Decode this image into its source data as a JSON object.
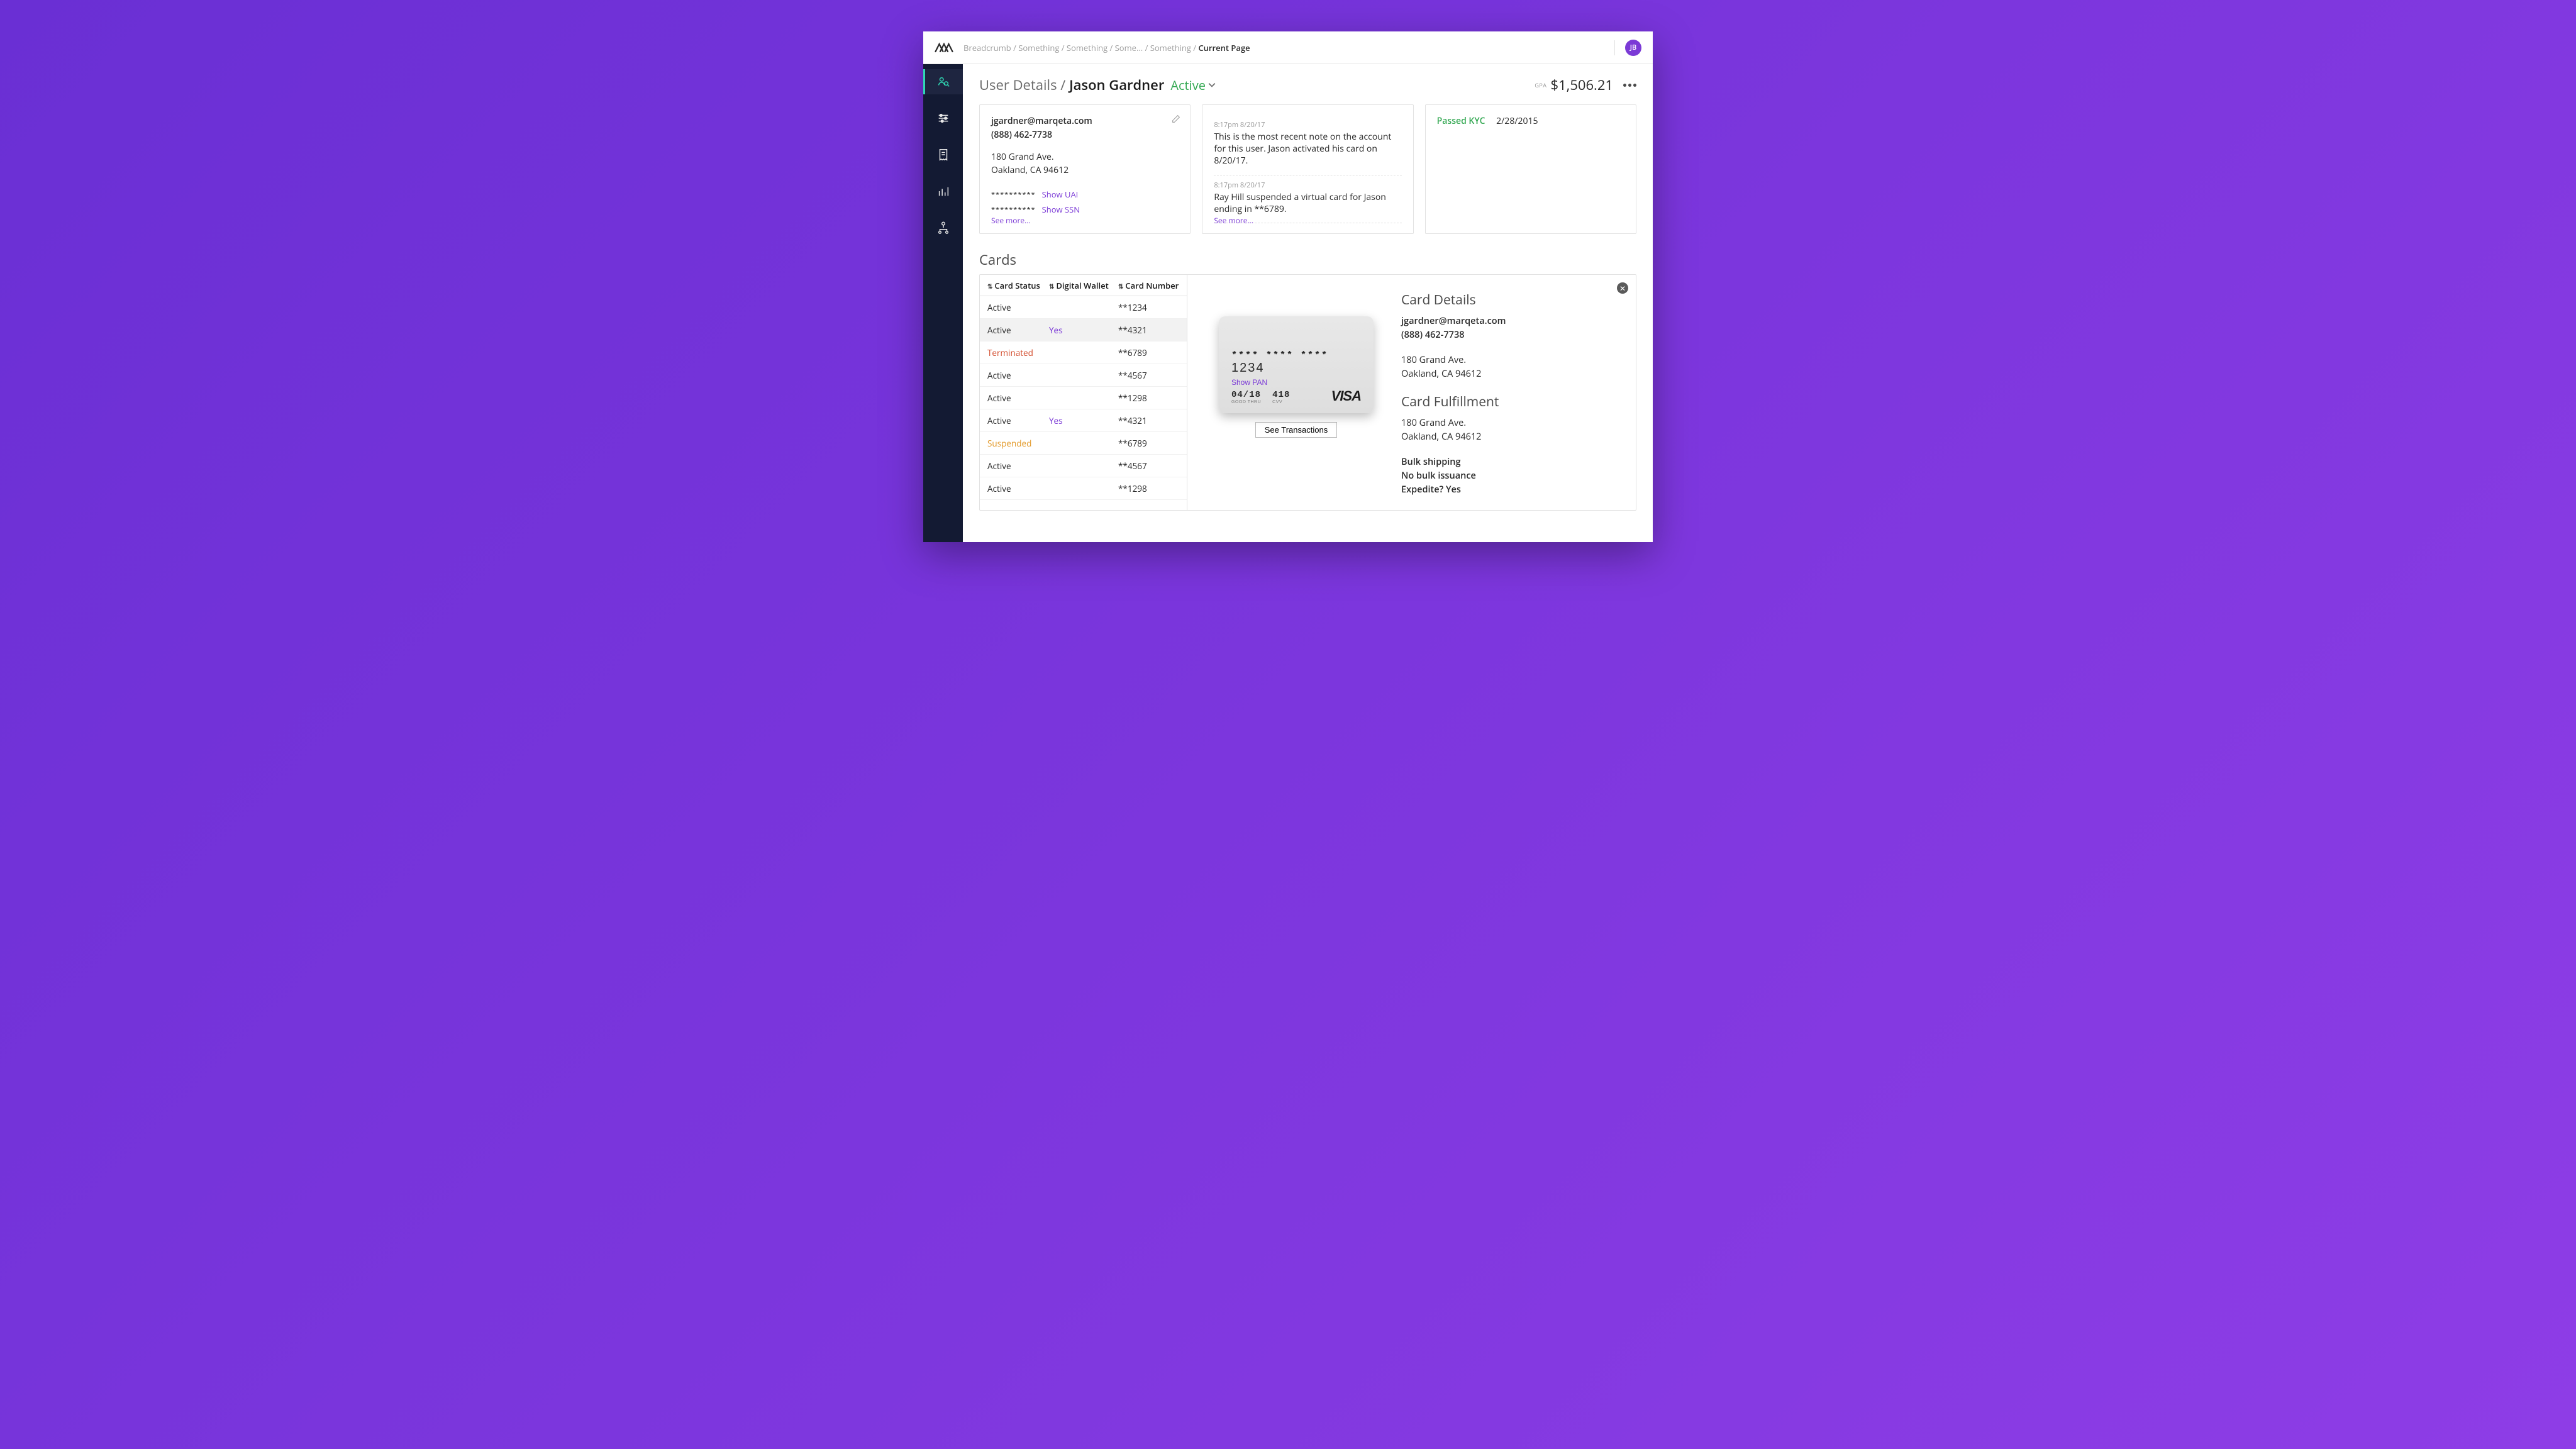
{
  "topbar": {
    "breadcrumb_prefix": "Breadcrumb / Something / Something / Some... / Something / ",
    "breadcrumb_current": "Current Page",
    "avatar_initials": "JB"
  },
  "header": {
    "title_prefix": "User Details / ",
    "title_name": "Jason Gardner",
    "status": "Active",
    "gpa_label": "GPA",
    "gpa_amount": "$1,506.21"
  },
  "contact": {
    "email": "jgardner@marqeta.com",
    "phone": "(888) 462-7738",
    "addr1": "180 Grand Ave.",
    "addr2": "Oakland, CA 94612",
    "uai_mask": "**********",
    "uai_link": "Show UAI",
    "ssn_mask": "**********",
    "ssn_link": "Show SSN",
    "see_more": "See more..."
  },
  "notes": [
    {
      "meta": "8:17pm 8/20/17",
      "body": "This is the most recent note on the account for this user. Jason activated his card on 8/20/17."
    },
    {
      "meta": "8:17pm 8/20/17",
      "body": "Ray Hill suspended a virtual card for Jason ending in **6789."
    }
  ],
  "notes_see_more": "See more...",
  "kyc": {
    "status": "Passed KYC",
    "date": "2/28/2015"
  },
  "cards_section_title": "Cards",
  "cards_table": {
    "headers": {
      "col1": "Card Status",
      "col2": "Digital Wallet",
      "col3": "Card Number"
    },
    "rows": [
      {
        "status": "Active",
        "wallet": "",
        "number": "**1234",
        "status_class": ""
      },
      {
        "status": "Active",
        "wallet": "Yes",
        "number": "**4321",
        "status_class": "",
        "selected": true
      },
      {
        "status": "Terminated",
        "wallet": "",
        "number": "**6789",
        "status_class": "status-terminated"
      },
      {
        "status": "Active",
        "wallet": "",
        "number": "**4567",
        "status_class": ""
      },
      {
        "status": "Active",
        "wallet": "",
        "number": "**1298",
        "status_class": ""
      },
      {
        "status": "Active",
        "wallet": "Yes",
        "number": "**4321",
        "status_class": ""
      },
      {
        "status": "Suspended",
        "wallet": "",
        "number": "**6789",
        "status_class": "status-suspended"
      },
      {
        "status": "Active",
        "wallet": "",
        "number": "**4567",
        "status_class": ""
      },
      {
        "status": "Active",
        "wallet": "",
        "number": "**1298",
        "status_class": ""
      }
    ]
  },
  "card_visual": {
    "pan_masked": "**** **** **** ",
    "pan_last4": "1234",
    "show_pan": "Show PAN",
    "exp": "04/18",
    "exp_label": "GOOD THRU",
    "cvv": "418",
    "cvv_label": "CVV",
    "brand": "VISA",
    "see_tx": "See Transactions"
  },
  "card_details": {
    "heading": "Card Details",
    "email": "jgardner@marqeta.com",
    "phone": "(888) 462-7738",
    "addr1": "180 Grand Ave.",
    "addr2": "Oakland, CA 94612",
    "fulfillment_heading": "Card Fulfillment",
    "f_addr1": "180 Grand Ave.",
    "f_addr2": "Oakland, CA 94612",
    "bulk_ship": "Bulk shipping",
    "bulk_iss": "No bulk issuance",
    "expedite": "Expedite? Yes"
  }
}
